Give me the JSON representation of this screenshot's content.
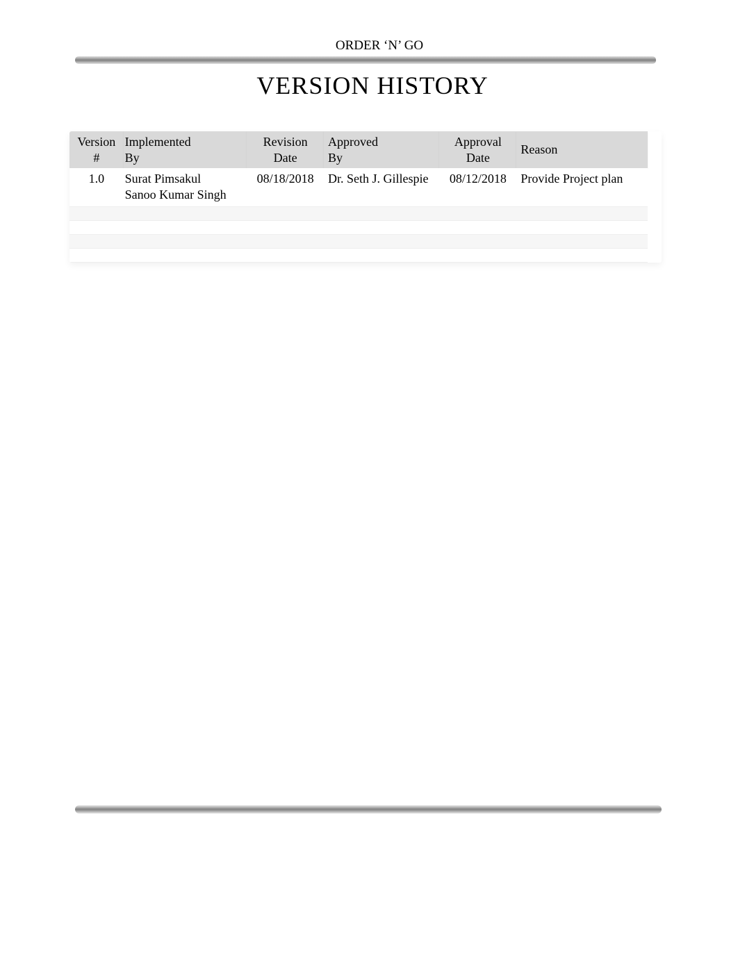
{
  "header": {
    "project_name": "ORDER ‘N’ GO"
  },
  "title": "VERSION HISTORY",
  "table": {
    "headers": {
      "version": {
        "line1": "Version",
        "line2": "#"
      },
      "implemented": {
        "line1": "Implemented",
        "line2": "By"
      },
      "revision": {
        "line1": "Revision",
        "line2": "Date"
      },
      "approved": {
        "line1": "Approved",
        "line2": "By"
      },
      "approval": {
        "line1": "Approval",
        "line2": "Date"
      },
      "reason": {
        "line1": "Reason",
        "line2": ""
      }
    },
    "rows": [
      {
        "version": "1.0",
        "implemented_by_line1": "Surat Pimsakul",
        "implemented_by_line2": "Sanoo Kumar Singh",
        "revision_date": "08/18/2018",
        "approved_by": "Dr. Seth J. Gillespie",
        "approval_date": "08/12/2018",
        "reason": "Provide Project plan"
      },
      {
        "version": "",
        "implemented_by_line1": "",
        "implemented_by_line2": "",
        "revision_date": "",
        "approved_by": "",
        "approval_date": "",
        "reason": ""
      },
      {
        "version": "",
        "implemented_by_line1": "",
        "implemented_by_line2": "",
        "revision_date": "",
        "approved_by": "",
        "approval_date": "",
        "reason": ""
      },
      {
        "version": "",
        "implemented_by_line1": "",
        "implemented_by_line2": "",
        "revision_date": "",
        "approved_by": "",
        "approval_date": "",
        "reason": ""
      },
      {
        "version": "",
        "implemented_by_line1": "",
        "implemented_by_line2": "",
        "revision_date": "",
        "approved_by": "",
        "approval_date": "",
        "reason": ""
      }
    ]
  }
}
